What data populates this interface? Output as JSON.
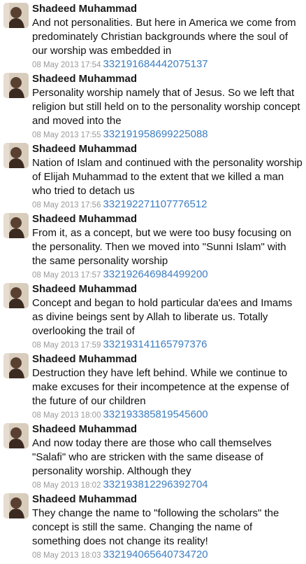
{
  "tweets": [
    {
      "author": "Shadeed Muhammad",
      "text": "And not personalities. But here in America we come from predominately Christian backgrounds where the soul of our worship was embedded in",
      "date": "08 May 2013 17:54",
      "id": "332191684442075137"
    },
    {
      "author": "Shadeed Muhammad",
      "text": "Personality worship namely that of Jesus. So we left that religion but still held on to the personality worship concept and moved into the",
      "date": "08 May 2013 17:55",
      "id": "332191958699225088"
    },
    {
      "author": "Shadeed Muhammad",
      "text": "Nation of Islam and continued with the personality worship of Elijah Muhammad to the extent that we killed a man who tried to detach us",
      "date": "08 May 2013 17:56",
      "id": "332192271107776512"
    },
    {
      "author": "Shadeed Muhammad",
      "text": "From it, as a concept, but we were too busy focusing on the personality. Then we moved into \"Sunni Islam\" with the same personality worship",
      "date": "08 May 2013 17:57",
      "id": "332192646984499200"
    },
    {
      "author": "Shadeed Muhammad",
      "text": "Concept and began to hold particular da'ees and Imams as divine beings sent by Allah to liberate us. Totally overlooking the trail of",
      "date": "08 May 2013 17:59",
      "id": "332193141165797376"
    },
    {
      "author": "Shadeed Muhammad",
      "text": "Destruction they have left behind. While we continue to make excuses for their incompetence at the expense of the future of our children",
      "date": "08 May 2013 18:00",
      "id": "332193385819545600"
    },
    {
      "author": "Shadeed Muhammad",
      "text": "And now today there are those who call themselves \"Salafi\" who are stricken with the same disease of personality worship. Although they",
      "date": "08 May 2013 18:02",
      "id": "332193812296392704"
    },
    {
      "author": "Shadeed Muhammad",
      "text": "They change the name to \"following the scholars\" the concept is still the same. Changing the name of something does not change its reality!",
      "date": "08 May 2013 18:03",
      "id": "332194065640734720"
    }
  ]
}
